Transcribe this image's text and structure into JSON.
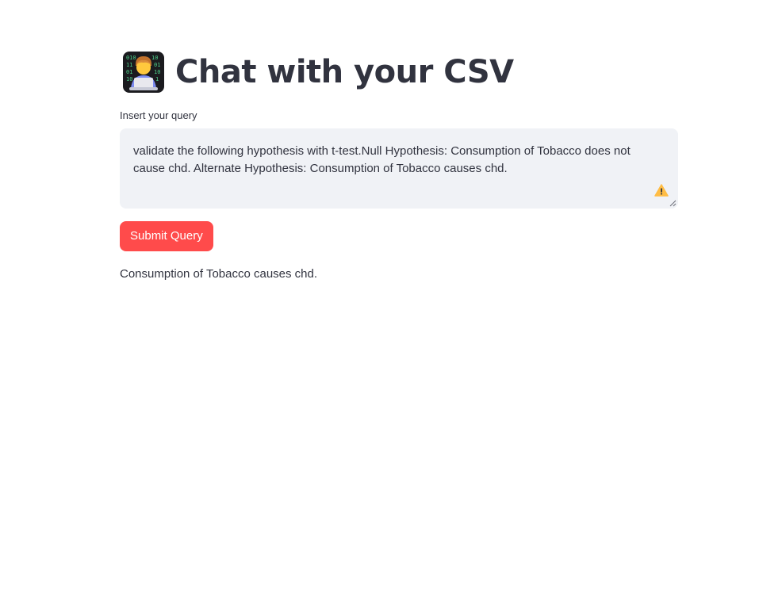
{
  "header": {
    "title": "Chat with your CSV",
    "title_icon": "technologist-emoji-icon"
  },
  "query": {
    "label": "Insert your query",
    "value": "validate the following hypothesis with t-test.Null Hypothesis: Consumption of Tobacco does not cause chd. Alternate Hypothesis: Consumption of Tobacco causes chd.",
    "status_icon": "warning-icon"
  },
  "actions": {
    "submit_label": "Submit Query"
  },
  "result": {
    "text": "Consumption of Tobacco causes chd."
  },
  "colors": {
    "primary_button": "#ff4b4b",
    "textarea_bg": "#f0f2f6",
    "text": "#31333f",
    "warning": "#ffbd45"
  }
}
